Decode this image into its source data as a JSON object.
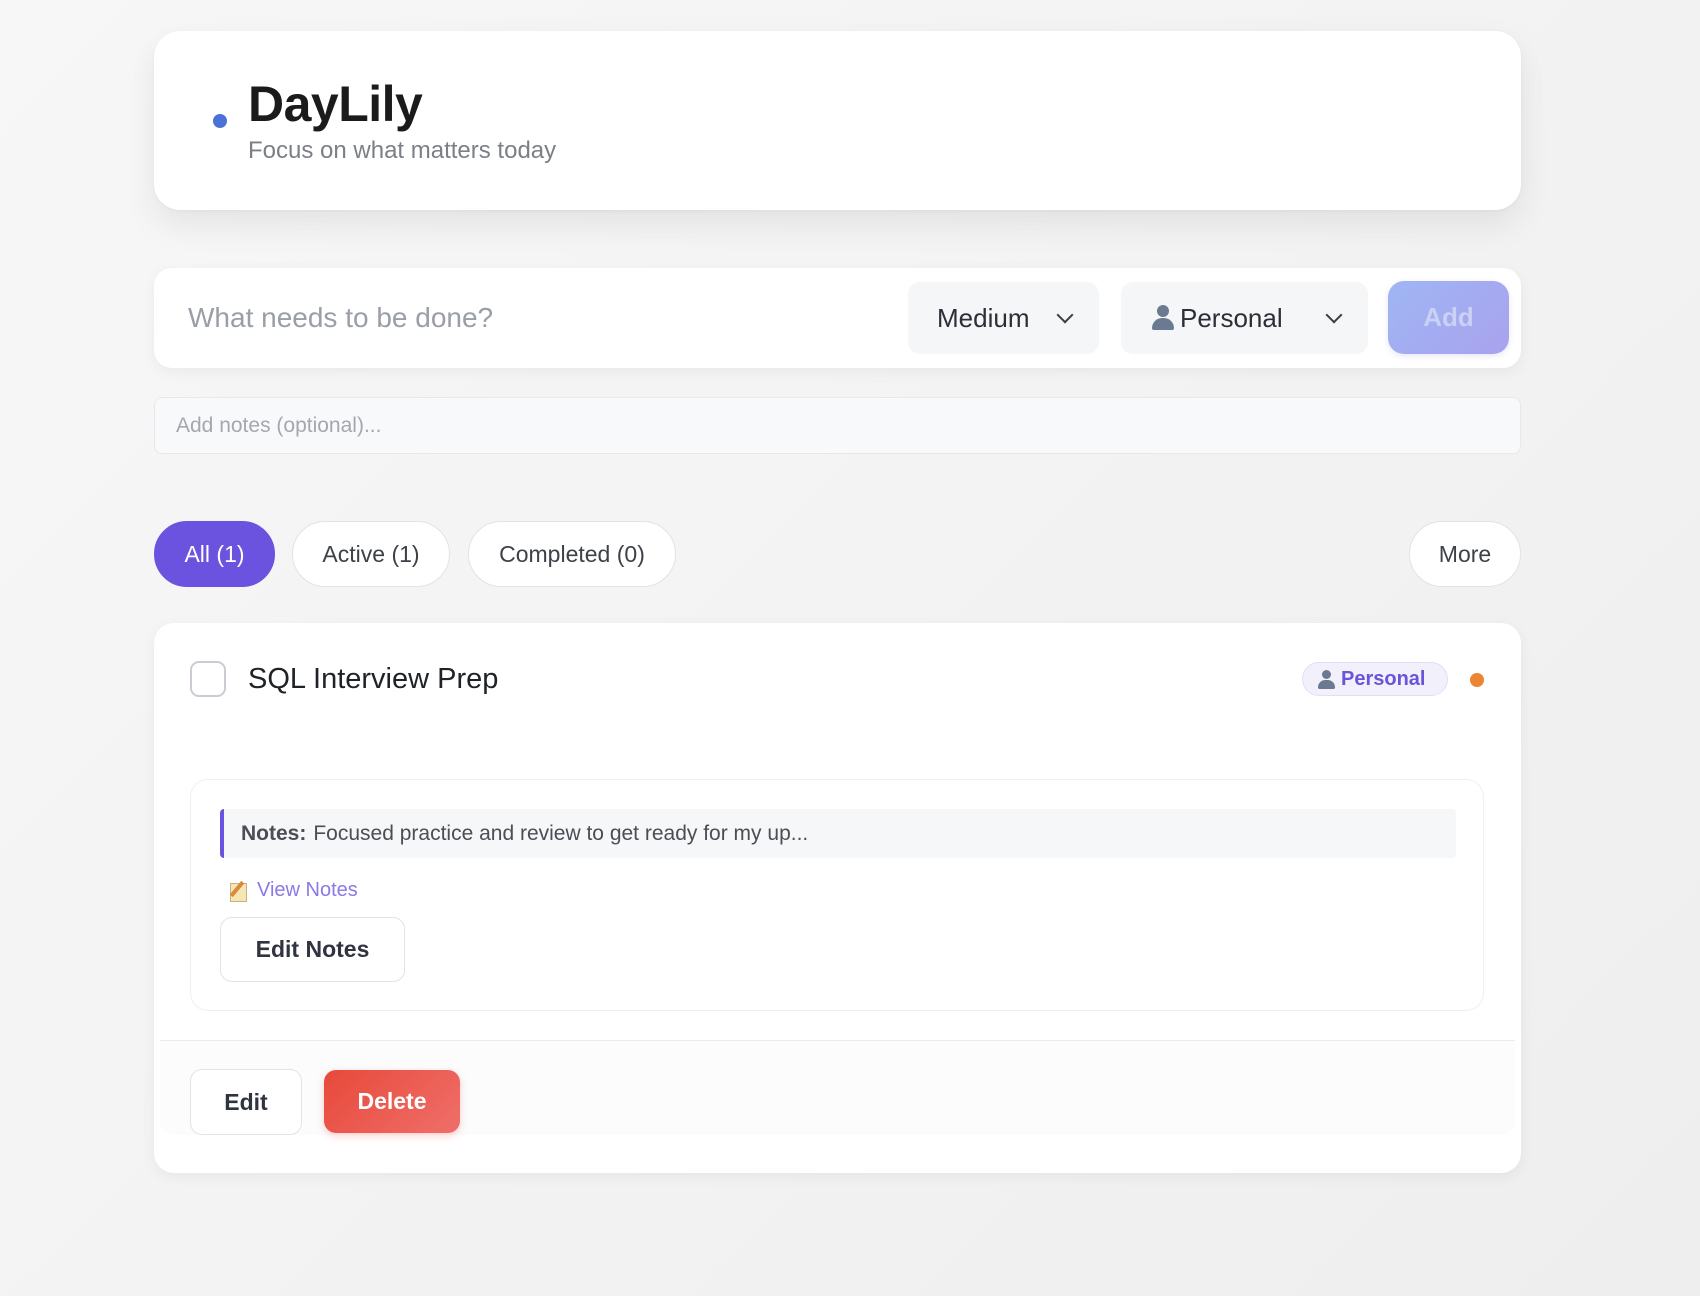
{
  "header": {
    "title": "DayLily",
    "subtitle": "Focus on what matters today"
  },
  "add_task": {
    "placeholder": "What needs to be done?",
    "priority_selected": "Medium",
    "category_selected": "Personal",
    "category_icon": "person-icon",
    "add_label": "Add"
  },
  "notes_input": {
    "placeholder": "Add notes (optional)..."
  },
  "filters": {
    "all": "All (1)",
    "active": "Active (1)",
    "completed": "Completed (0)",
    "more": "More",
    "selected": "all"
  },
  "tasks": [
    {
      "title": "SQL Interview Prep",
      "completed": false,
      "category": "Personal",
      "priority_color": "#ec8431",
      "notes_label": "Notes:",
      "notes_preview": "Focused practice and review to get ready for my up...",
      "view_notes_label": "View Notes",
      "edit_notes_label": "Edit Notes",
      "edit_label": "Edit",
      "delete_label": "Delete"
    }
  ],
  "colors": {
    "accent": "#6b53e0",
    "brand_dot": "#4a72d8",
    "danger": "#e8493a"
  }
}
